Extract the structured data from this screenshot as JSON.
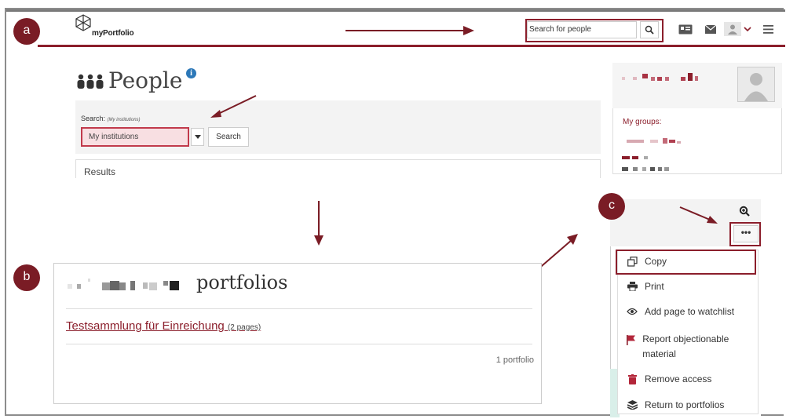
{
  "annotations": {
    "a": "a",
    "b": "b",
    "c": "c"
  },
  "navbar": {
    "logo_text": "myPortfolio",
    "search_placeholder": "Search for people",
    "icons": [
      "search-icon",
      "card-icon",
      "mail-icon",
      "user-icon",
      "chevron-down-icon",
      "hamburger-menu-icon"
    ]
  },
  "people_page": {
    "title": "People",
    "search_label": "Search:",
    "search_scope_hint": "(My institutions)",
    "scope_select_value": "My institutions",
    "search_button": "Search",
    "results_heading": "Results"
  },
  "sidebar": {
    "my_groups_label": "My groups:"
  },
  "portfolios_card": {
    "title": "portfolios",
    "portfolio_name": "Testsammlung für Einreichung",
    "portfolio_pages": "(2 pages)",
    "portfolio_count": "1 portfolio"
  },
  "page_menu": {
    "more_label": "•••",
    "items": [
      {
        "label": "Copy",
        "icon": "copy-icon"
      },
      {
        "label": "Print",
        "icon": "print-icon"
      },
      {
        "label": "Add page to watchlist",
        "icon": "eye-icon"
      },
      {
        "label": "Report objectionable material",
        "icon": "flag-icon"
      },
      {
        "label": "Remove access",
        "icon": "trash-icon"
      },
      {
        "label": "Return to portfolios",
        "icon": "stack-icon"
      }
    ]
  },
  "colors": {
    "accent": "#8b1e2b",
    "label_circle": "#7a1c25",
    "info": "#2c78b8"
  }
}
